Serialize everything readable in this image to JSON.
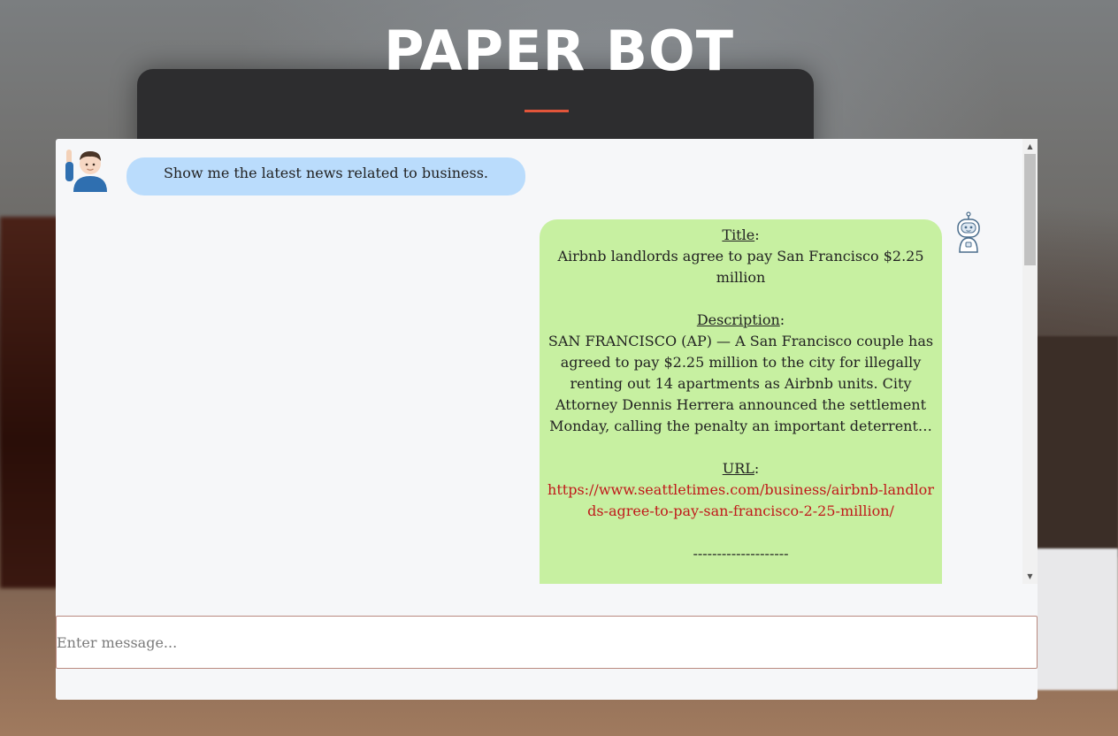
{
  "header": {
    "title": "PAPER BOT"
  },
  "colors": {
    "accent_divider": "#e2553a",
    "user_bubble": "#badcfc",
    "bot_bubble": "#c7f0a1",
    "link": "#c0191a"
  },
  "messages": {
    "user": {
      "avatar_icon": "person-raising-hand-icon",
      "text": "Show me the latest news related to business."
    },
    "bot": {
      "avatar_icon": "robot-icon",
      "title_label": "Title",
      "title": "Airbnb landlords agree to pay San Francisco $2.25 million",
      "description_label": "Description",
      "description": "SAN FRANCISCO (AP) — A San Francisco couple has agreed to pay $2.25 million to the city for illegally renting out 14 apartments as Airbnb units. City Attorney Dennis Herrera announced the settlement Monday, calling the penalty an important deterrent…",
      "url_label": "URL",
      "url": "https://www.seattletimes.com/business/airbnb-landlords-agree-to-pay-san-francisco-2-25-million/",
      "separator": "--------------------"
    }
  },
  "input": {
    "placeholder": "Enter message...",
    "value": ""
  },
  "scrollbar": {
    "up_icon": "▲",
    "down_icon": "▼"
  }
}
